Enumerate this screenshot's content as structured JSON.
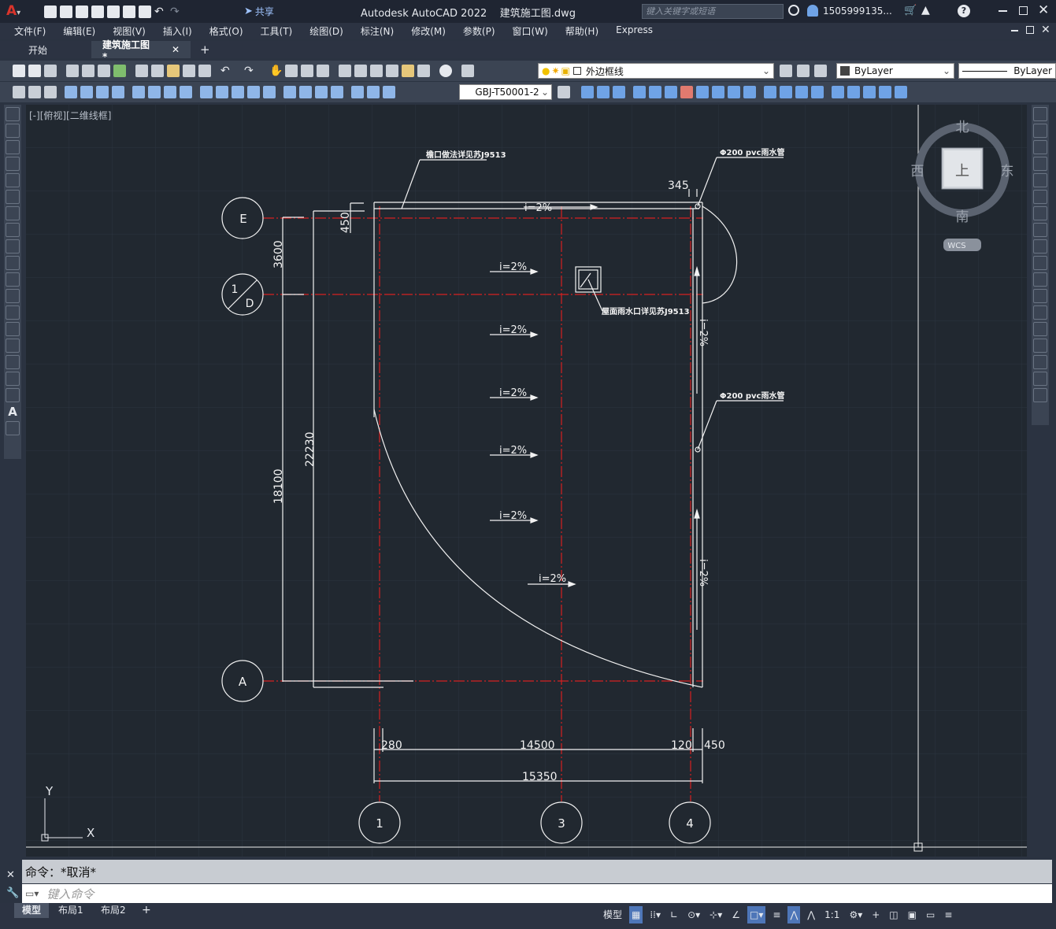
{
  "titlebar": {
    "app_title": "Autodesk AutoCAD 2022",
    "file_name": "建筑施工图.dwg",
    "share_label": "共享",
    "search_placeholder": "键入关键字或短语",
    "user": "1505999135..."
  },
  "menu": [
    "文件(F)",
    "编辑(E)",
    "视图(V)",
    "插入(I)",
    "格式(O)",
    "工具(T)",
    "绘图(D)",
    "标注(N)",
    "修改(M)",
    "参数(P)",
    "窗口(W)",
    "帮助(H)",
    "Express"
  ],
  "tabs": {
    "start": "开始",
    "drawing": "建筑施工图*"
  },
  "toolbar": {
    "layer": "外边框线",
    "color": "ByLayer",
    "linetype": "ByLayer",
    "dimstyle": "GBJ-T50001-2"
  },
  "viewport": {
    "label": "[-][俯视][二维线框]"
  },
  "viewcube": {
    "north": "北",
    "south": "南",
    "east": "东",
    "west": "西",
    "top": "上",
    "wcs": "WCS"
  },
  "ucs": {
    "x": "X",
    "y": "Y"
  },
  "drawing": {
    "axes_left": [
      "E",
      "1/D",
      "A"
    ],
    "axes_left_E": "E",
    "axis_D_top": "1",
    "axis_D_bottom": "D",
    "axis_A": "A",
    "axes_bottom": [
      "1",
      "3",
      "4"
    ],
    "axis_1": "1",
    "axis_3": "3",
    "axis_4": "4",
    "dims": {
      "d3600": "3600",
      "d18100": "18100",
      "d22230": "22230",
      "d450": "450",
      "d345": "345",
      "d280": "280",
      "d14500": "14500",
      "d120": "120",
      "d450b": "450",
      "d15350": "15350"
    },
    "slopes": [
      "i=2%",
      "i=2%",
      "i=2%",
      "i=2%",
      "i=2%",
      "i=2%",
      "i=2%"
    ],
    "slope_top": "i=2%",
    "slope_v1": "i=2%",
    "slope_v2": "i=2%",
    "notes": {
      "n1": "檐口做法详见苏J9513",
      "n2": "Φ200 pvc雨水管",
      "n3": "屋面雨水口详见苏J9513",
      "n4": "Φ200 pvc雨水管"
    }
  },
  "command": {
    "history": "命令：*取消*",
    "placeholder": "键入命令"
  },
  "layouts": {
    "model": "模型",
    "layout1": "布局1",
    "layout2": "布局2"
  },
  "status": {
    "model": "模型",
    "scale": "1:1"
  }
}
